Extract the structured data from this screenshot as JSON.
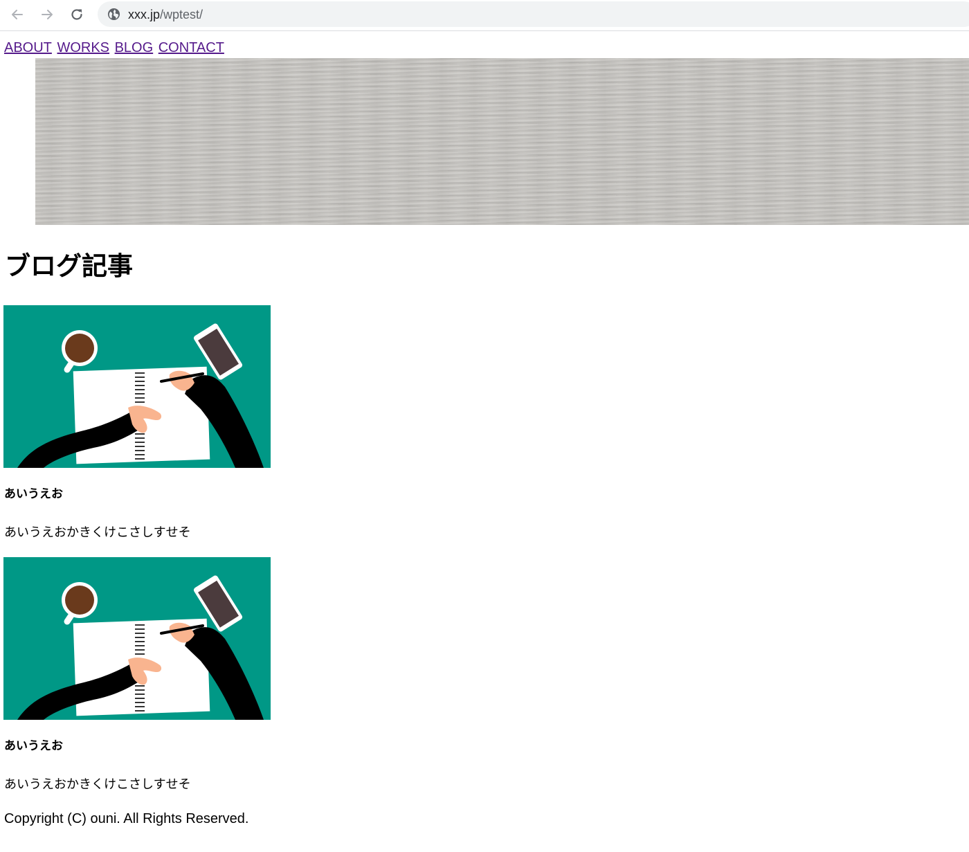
{
  "browser": {
    "url_host": "xxx.jp",
    "url_path": "/wptest/",
    "back_icon": "arrow-left-icon",
    "forward_icon": "arrow-right-icon",
    "reload_icon": "reload-icon",
    "site_info_icon": "globe-icon"
  },
  "nav": {
    "items": [
      {
        "label": "ABOUT"
      },
      {
        "label": "WORKS"
      },
      {
        "label": "BLOG"
      },
      {
        "label": "CONTACT"
      }
    ],
    "link_color": "#551a8b"
  },
  "hero": {
    "color": "#c7c5c1"
  },
  "blog": {
    "heading": "ブログ記事",
    "posts": [
      {
        "title": "あいうえお",
        "excerpt": "あいうえおかきくけこさしすせそ"
      },
      {
        "title": "あいうえお",
        "excerpt": "あいうえおかきくけこさしすせそ"
      }
    ],
    "thumb_colors": {
      "background": "#009886",
      "cup": "#6a3a1c",
      "phone": "#4b3b3d",
      "skin": "#f9b48f",
      "sleeve": "#000000"
    }
  },
  "footer": {
    "copyright": "Copyright (C) ouni. All Rights Reserved."
  }
}
